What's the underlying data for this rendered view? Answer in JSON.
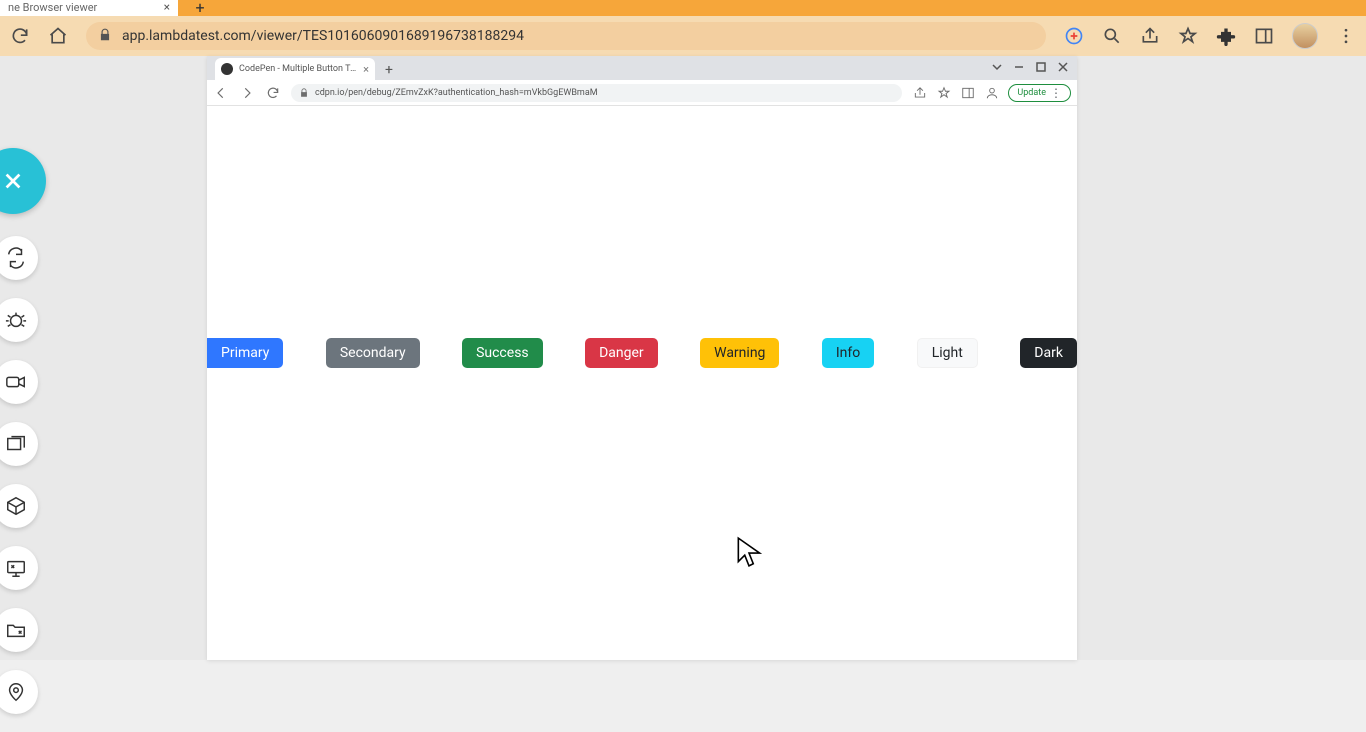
{
  "outer_browser": {
    "tab_title": "ne Browser viewer",
    "url": "app.lambdatest.com/viewer/TES10160609016891967381​88294"
  },
  "sidebar": {
    "close_label": "Close"
  },
  "vm_browser": {
    "tab_title": "CodePen - Multiple Button Tran…",
    "url": "cdpn.io/pen/debug/ZEmvZxK?authentication_hash=mVkbGgEWBmaM",
    "update_label": "Update"
  },
  "buttons": {
    "primary": "Primary",
    "secondary": "Secondary",
    "success": "Success",
    "danger": "Danger",
    "warning": "Warning",
    "info": "Info",
    "light": "Light",
    "dark": "Dark"
  }
}
